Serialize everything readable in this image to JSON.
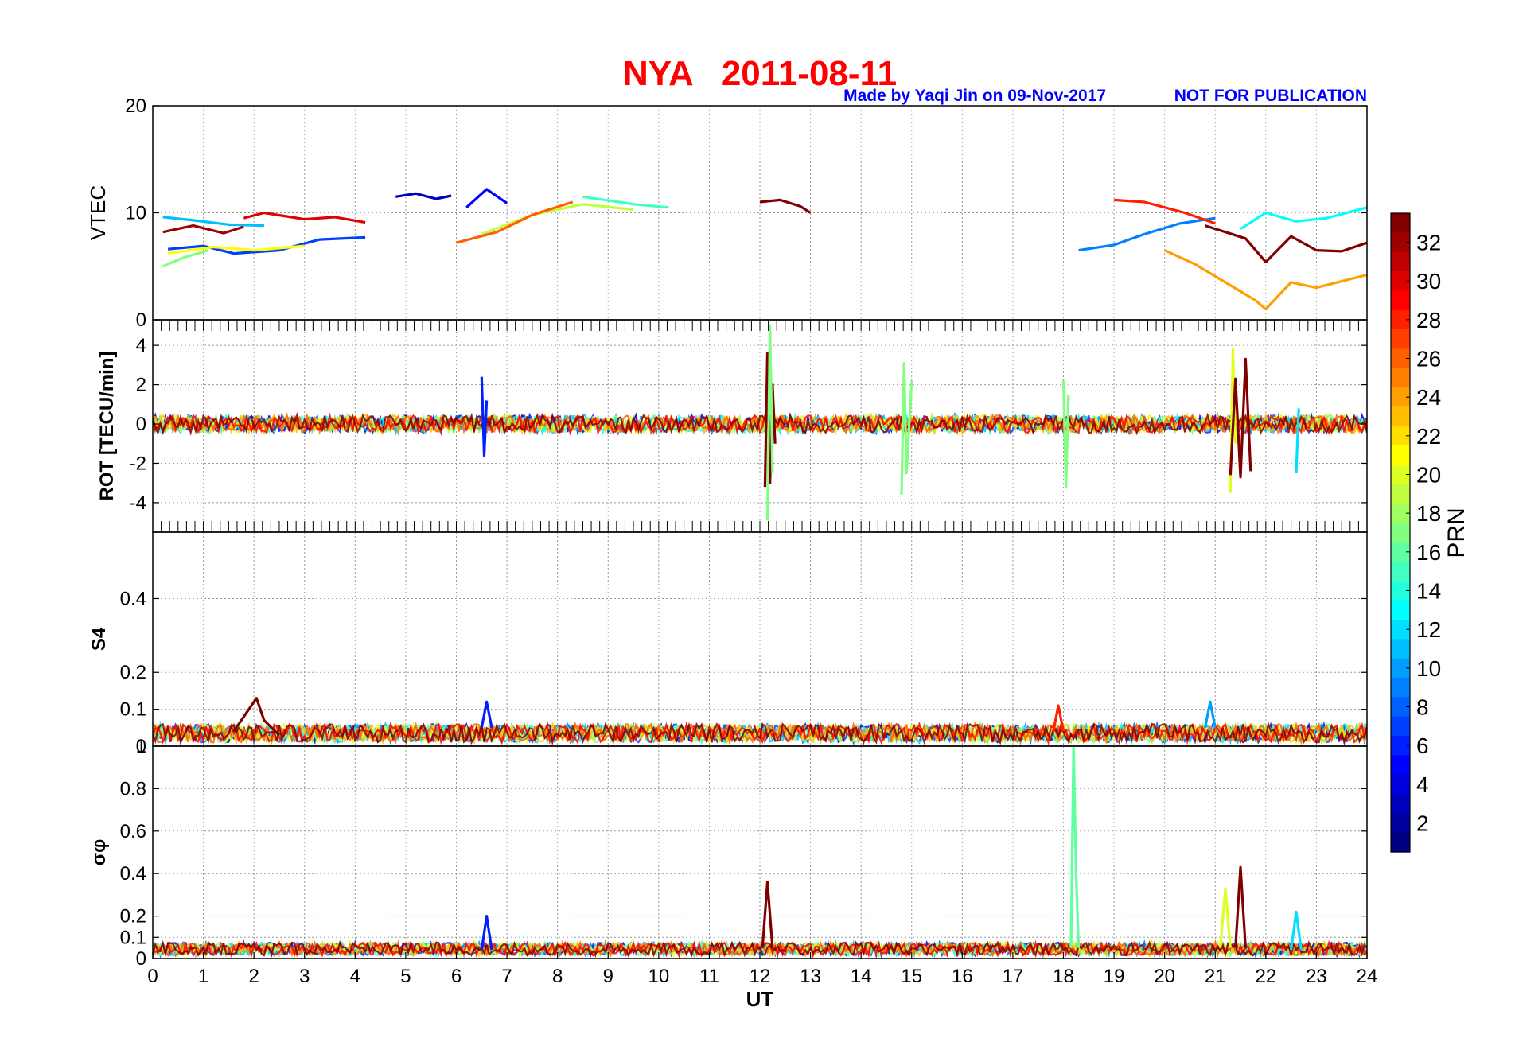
{
  "figure": {
    "title": "NYA   2011-08-11",
    "credit": "Made by Yaqi Jin on 09-Nov-2017",
    "notice": "NOT FOR PUBLICATION",
    "title_color": "#ff0000",
    "credit_color": "#0000ff",
    "xlabel": "UT",
    "xticks": [
      "0",
      "1",
      "2",
      "3",
      "4",
      "5",
      "6",
      "7",
      "8",
      "9",
      "10",
      "11",
      "12",
      "13",
      "14",
      "15",
      "16",
      "17",
      "18",
      "19",
      "20",
      "21",
      "22",
      "23",
      "24"
    ],
    "colorbar": {
      "label": "PRN",
      "colormap": "jet",
      "range": [
        1,
        33
      ],
      "ticks": [
        "2",
        "4",
        "6",
        "8",
        "10",
        "12",
        "14",
        "16",
        "18",
        "20",
        "22",
        "24",
        "26",
        "28",
        "30",
        "32"
      ]
    }
  },
  "chart_data": [
    {
      "type": "line",
      "panel": "vtec",
      "ylabel": "VTEC",
      "xlim": [
        0,
        24
      ],
      "ylim": [
        0,
        20
      ],
      "yticks": [
        "0",
        "10",
        "20"
      ],
      "grid": true,
      "series": [
        {
          "prn": 3,
          "x": [
            4.8,
            5.2,
            5.6,
            5.9
          ],
          "y": [
            11.5,
            11.8,
            11.3,
            11.6
          ]
        },
        {
          "prn": 5,
          "x": [
            6.2,
            6.6,
            7.0
          ],
          "y": [
            10.5,
            12.2,
            10.9
          ]
        },
        {
          "prn": 7,
          "x": [
            0.3,
            1.0,
            1.6,
            2.5,
            3.3,
            4.2
          ],
          "y": [
            6.6,
            6.9,
            6.2,
            6.5,
            7.5,
            7.7
          ]
        },
        {
          "prn": 9,
          "x": [
            18.3,
            19.0,
            19.6,
            20.3,
            21.0
          ],
          "y": [
            6.5,
            7.0,
            8.0,
            9.0,
            9.5
          ]
        },
        {
          "prn": 11,
          "x": [
            0.2,
            0.8,
            1.5,
            2.2
          ],
          "y": [
            9.6,
            9.3,
            8.9,
            8.8
          ]
        },
        {
          "prn": 13,
          "x": [
            21.5,
            22.0,
            22.6,
            23.2,
            24.0
          ],
          "y": [
            8.5,
            10.0,
            9.2,
            9.5,
            10.5
          ]
        },
        {
          "prn": 15,
          "x": [
            8.5,
            9.5,
            10.2
          ],
          "y": [
            11.5,
            10.8,
            10.5
          ]
        },
        {
          "prn": 17,
          "x": [
            0.2,
            0.6,
            1.1
          ],
          "y": [
            5.0,
            5.8,
            6.5
          ]
        },
        {
          "prn": 19,
          "x": [
            6.5,
            7.5,
            8.5,
            9.5
          ],
          "y": [
            8.0,
            9.8,
            10.8,
            10.3
          ]
        },
        {
          "prn": 21,
          "x": [
            0.3,
            1.2,
            2.0,
            3.0
          ],
          "y": [
            6.2,
            6.8,
            6.5,
            6.9
          ]
        },
        {
          "prn": 24,
          "x": [
            20.0,
            20.6,
            21.2,
            21.8,
            22.0,
            22.5,
            23.0,
            24.0
          ],
          "y": [
            6.5,
            5.2,
            3.5,
            1.8,
            1.0,
            3.5,
            3.0,
            4.2
          ]
        },
        {
          "prn": 26,
          "x": [
            6.0,
            6.8,
            7.5,
            8.3
          ],
          "y": [
            7.2,
            8.2,
            9.8,
            11.0
          ]
        },
        {
          "prn": 28,
          "x": [
            19.0,
            19.6,
            20.4,
            21.0
          ],
          "y": [
            11.2,
            11.0,
            10.0,
            9.0
          ]
        },
        {
          "prn": 30,
          "x": [
            1.8,
            2.2,
            3.0,
            3.6,
            4.2
          ],
          "y": [
            9.5,
            10.0,
            9.4,
            9.6,
            9.1
          ]
        },
        {
          "prn": 32,
          "x": [
            0.2,
            0.8,
            1.4,
            1.8
          ],
          "y": [
            8.2,
            8.8,
            8.1,
            8.7
          ]
        },
        {
          "prn": 33,
          "x": [
            12.0,
            12.4,
            12.8,
            13.0
          ],
          "y": [
            11.0,
            11.2,
            10.6,
            10.0
          ]
        },
        {
          "prn": 33,
          "x": [
            20.8,
            21.2,
            21.6,
            22.0,
            22.5,
            23.0,
            23.5,
            24.0
          ],
          "y": [
            8.8,
            8.2,
            7.6,
            5.4,
            7.8,
            6.5,
            6.4,
            7.2
          ]
        }
      ]
    },
    {
      "type": "line",
      "panel": "rot",
      "ylabel": "ROT [TECU/min]",
      "xlim": [
        0,
        24
      ],
      "ylim": [
        -5.5,
        5.3
      ],
      "yticks": [
        "-4",
        "-2",
        "0",
        "2",
        "4"
      ],
      "grid": true,
      "series": [
        {
          "prn": 33,
          "x": [
            12.1,
            12.15,
            12.2,
            12.25,
            12.3
          ],
          "y": [
            -3.2,
            3.6,
            -3.0,
            2.0,
            -1.0
          ]
        },
        {
          "prn": 17,
          "x": [
            12.15,
            12.2,
            12.25
          ],
          "y": [
            -4.9,
            5.0,
            -2.5
          ]
        },
        {
          "prn": 17,
          "x": [
            14.8,
            14.85,
            14.9,
            15.0
          ],
          "y": [
            -3.6,
            3.1,
            -2.5,
            2.2
          ]
        },
        {
          "prn": 17,
          "x": [
            18.0,
            18.05,
            18.1
          ],
          "y": [
            2.2,
            -3.2,
            1.5
          ]
        },
        {
          "prn": 20,
          "x": [
            21.3,
            21.35,
            21.4
          ],
          "y": [
            -3.5,
            3.8,
            -1.0
          ]
        },
        {
          "prn": 33,
          "x": [
            21.3,
            21.4,
            21.5,
            21.6,
            21.7
          ],
          "y": [
            -2.6,
            2.3,
            -2.7,
            3.3,
            -2.4
          ]
        },
        {
          "prn": 12,
          "x": [
            22.6,
            22.65
          ],
          "y": [
            -2.5,
            0.8
          ]
        },
        {
          "prn": 6,
          "x": [
            6.5,
            6.55,
            6.6
          ],
          "y": [
            2.4,
            -1.6,
            1.2
          ]
        }
      ]
    },
    {
      "type": "line",
      "panel": "s4",
      "ylabel": "S4",
      "xlim": [
        0,
        24
      ],
      "ylim": [
        0,
        0.58
      ],
      "yticks": [
        "0",
        "0.1",
        "0.2",
        "0.4"
      ],
      "grid": true,
      "series": [
        {
          "prn": 33,
          "x": [
            1.6,
            1.9,
            2.05,
            2.2,
            2.5
          ],
          "y": [
            0.04,
            0.1,
            0.13,
            0.07,
            0.03
          ]
        },
        {
          "prn": 28,
          "x": [
            17.8,
            17.9,
            18.0
          ],
          "y": [
            0.04,
            0.11,
            0.04
          ]
        },
        {
          "prn": 10,
          "x": [
            20.8,
            20.9,
            21.0
          ],
          "y": [
            0.05,
            0.12,
            0.05
          ]
        },
        {
          "prn": 6,
          "x": [
            6.5,
            6.6,
            6.7
          ],
          "y": [
            0.05,
            0.12,
            0.05
          ]
        }
      ]
    },
    {
      "type": "line",
      "panel": "sigma_phi",
      "ylabel": "σφ",
      "xlim": [
        0,
        24
      ],
      "ylim": [
        0,
        1
      ],
      "yticks": [
        "0",
        "0.1",
        "0.2",
        "0.4",
        "0.6",
        "0.8",
        "1"
      ],
      "grid": true,
      "series": [
        {
          "prn": 16,
          "x": [
            18.15,
            18.2,
            18.25,
            18.3
          ],
          "y": [
            0.05,
            1.0,
            0.4,
            0.05
          ]
        },
        {
          "prn": 33,
          "x": [
            12.05,
            12.15,
            12.25
          ],
          "y": [
            0.05,
            0.36,
            0.05
          ]
        },
        {
          "prn": 20,
          "x": [
            21.1,
            21.2,
            21.3
          ],
          "y": [
            0.05,
            0.33,
            0.05
          ]
        },
        {
          "prn": 33,
          "x": [
            21.4,
            21.5,
            21.6
          ],
          "y": [
            0.05,
            0.43,
            0.05
          ]
        },
        {
          "prn": 12,
          "x": [
            22.5,
            22.6,
            22.7
          ],
          "y": [
            0.04,
            0.22,
            0.04
          ]
        },
        {
          "prn": 6,
          "x": [
            6.5,
            6.6,
            6.7
          ],
          "y": [
            0.04,
            0.2,
            0.04
          ]
        }
      ]
    }
  ]
}
